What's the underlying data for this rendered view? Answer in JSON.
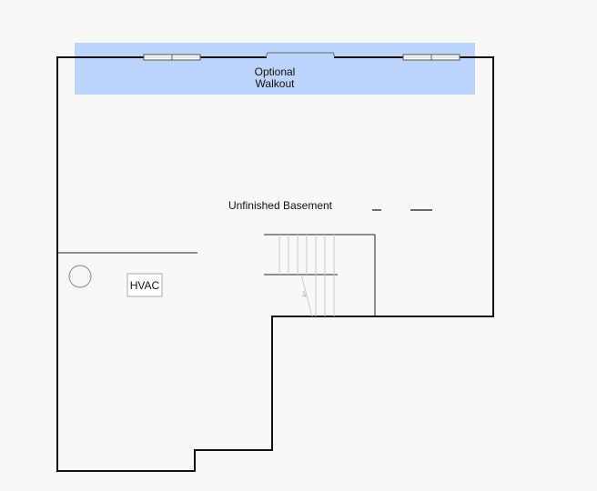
{
  "plan": {
    "rooms": {
      "walkout_line1": "Optional",
      "walkout_line2": "Walkout",
      "basement": "Unfinished Basement",
      "hvac": "HVAC"
    },
    "colors": {
      "walkout_fill": "#bcd4fb",
      "wall": "#111111",
      "background": "#f8f8f8",
      "stair_line": "#c8c8c8"
    }
  }
}
